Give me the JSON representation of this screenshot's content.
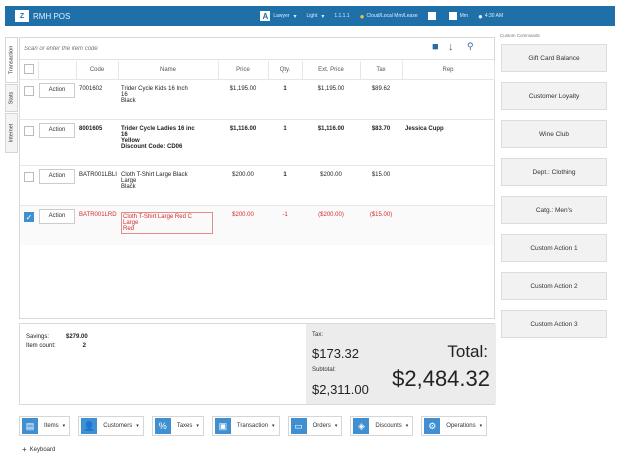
{
  "titlebar": {
    "logo": "Z",
    "title": "RMH POS",
    "items": [
      {
        "icon": "A",
        "label": "Lawyer",
        "caret": "▾"
      },
      {
        "icon": "",
        "label": "Light",
        "caret": "▾"
      },
      {
        "icon": "",
        "label": "1.1.1.1",
        "caret": ""
      },
      {
        "icon": "●",
        "label": "Cloud/Local Mm/Lease",
        "caret": ""
      },
      {
        "icon": "",
        "label": "",
        "caret": ""
      },
      {
        "icon": "",
        "label": "Mm",
        "caret": ""
      },
      {
        "icon": "●",
        "label": "4:30 AM",
        "caret": ""
      }
    ]
  },
  "sidetabs": [
    "Transaction",
    "Stats",
    "Internet"
  ],
  "search": {
    "placeholder": "Scan or enter the item code"
  },
  "table": {
    "headers": [
      "",
      "",
      "Code",
      "Name",
      "Price",
      "Qty.",
      "Ext. Price",
      "Tax",
      "Rep"
    ],
    "rows": [
      {
        "checked": false,
        "action": "Action",
        "code": "7001602",
        "name": [
          "Trider Cycle Kids 16 Inch",
          "16",
          "Black"
        ],
        "price": "$1,195.00",
        "qty": "1",
        "ext": "$1,195.00",
        "tax": "$89.62",
        "rep": "",
        "bold": false,
        "red": false
      },
      {
        "checked": false,
        "action": "Action",
        "code": "8001605",
        "name": [
          "Trider Cycle Ladies 16 inc",
          "16",
          "Yellow",
          "Discount Code: CD06"
        ],
        "price": "$1,116.00",
        "qty": "1",
        "ext": "$1,116.00",
        "tax": "$83.70",
        "rep": "Jessica Cupp",
        "bold": true,
        "red": false
      },
      {
        "checked": false,
        "action": "Action",
        "code": "BATR001LBLI",
        "name": [
          "Cloth T-Shirt Large Black",
          "Large",
          "Black"
        ],
        "price": "$200.00",
        "qty": "1",
        "ext": "$200.00",
        "tax": "$15.00",
        "rep": "",
        "bold": false,
        "red": false
      },
      {
        "checked": true,
        "action": "Action",
        "code": "BATR001LRD",
        "name": [
          "Cloth T-Shirt Large Red C",
          "Large",
          "Red"
        ],
        "price": "$200.00",
        "qty": "-1",
        "ext": "($200.00)",
        "tax": "($15.00)",
        "rep": "",
        "bold": false,
        "red": true
      }
    ]
  },
  "summary": {
    "savings_label": "Savings:",
    "savings_value": "$279.00",
    "count_label": "Item count:",
    "count_value": "2",
    "tax_label": "Tax:",
    "tax_value": "$173.32",
    "subtotal_label": "Subtotal:",
    "subtotal_value": "$2,311.00",
    "total_label": "Total:",
    "total_value": "$2,484.32"
  },
  "custom": {
    "title": "Custom Commands",
    "buttons": [
      "Gift Card Balance",
      "Customer Loyalty",
      "Wine Club",
      "Dept.: Clothing",
      "Catg.: Men's",
      "Custom Action 1",
      "Custom Action 2",
      "Custom Action 3"
    ]
  },
  "bottombar": [
    {
      "icon": "▤",
      "label": "Items"
    },
    {
      "icon": "👤",
      "label": "Customers"
    },
    {
      "icon": "%",
      "label": "Taxes"
    },
    {
      "icon": "▣",
      "label": "Transaction"
    },
    {
      "icon": "▭",
      "label": "Orders"
    },
    {
      "icon": "◈",
      "label": "Discounts"
    },
    {
      "icon": "⚙",
      "label": "Operations"
    }
  ],
  "keyboard": {
    "label": "Keyboard",
    "icon": "+"
  },
  "colors": {
    "titlebar": "#1f6fa8",
    "accent": "#3f8fd1",
    "error": "#d62b2b"
  }
}
